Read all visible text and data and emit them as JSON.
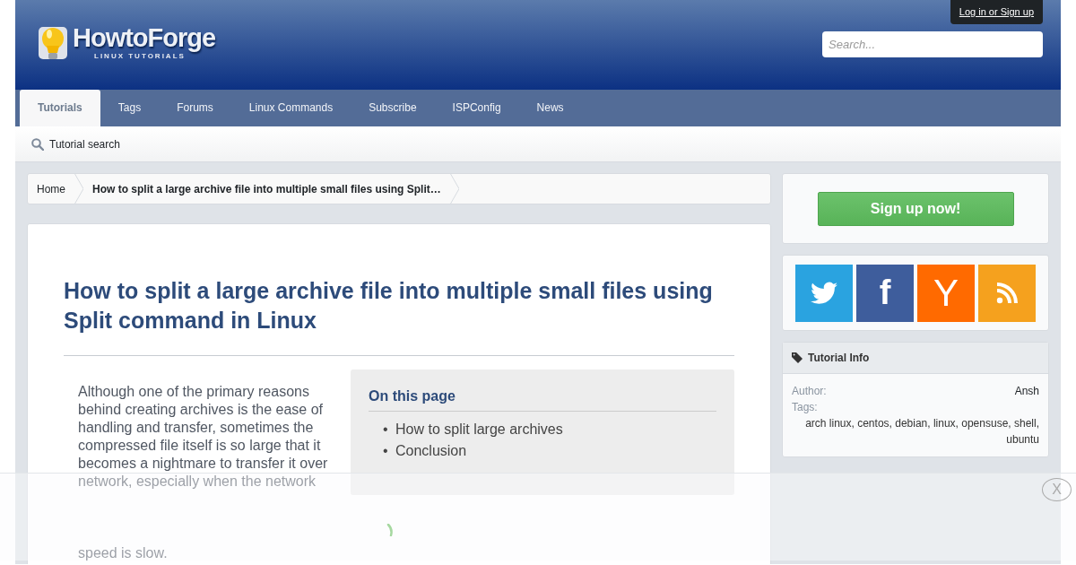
{
  "header": {
    "logo": {
      "name": "HowtoForge",
      "tagline": "LINUX TUTORIALS"
    },
    "login": "Log in or Sign up",
    "search": {
      "placeholder": "Search..."
    }
  },
  "nav": [
    {
      "label": "Tutorials",
      "selected": true
    },
    {
      "label": "Tags",
      "selected": false
    },
    {
      "label": "Forums",
      "selected": false
    },
    {
      "label": "Linux Commands",
      "selected": false
    },
    {
      "label": "Subscribe",
      "selected": false
    },
    {
      "label": "ISPConfig",
      "selected": false
    },
    {
      "label": "News",
      "selected": false
    }
  ],
  "subnav": {
    "search_link": "Tutorial search"
  },
  "breadcrumb": [
    "Home",
    "How to split a large archive file into multiple small files using Split…"
  ],
  "article": {
    "title": "How to split a large archive file into multiple small files using Split command in Linux",
    "intro": "Although one of the primary reasons behind creating archives is the ease of handling and transfer, sometimes the compressed file itself is so large that it becomes a nightmare to transfer it over network, especially when the network",
    "intro_end": "speed is slow.",
    "toc": {
      "title": "On this page",
      "bullet": "•",
      "items": [
        "How to split large archives",
        "Conclusion"
      ]
    }
  },
  "sidebar": {
    "signup": "Sign up now!",
    "social": [
      {
        "kind": "twitter",
        "color": "#2aa3e0"
      },
      {
        "kind": "facebook",
        "glyph": "f",
        "color": "#3e5d9c"
      },
      {
        "kind": "hackernews",
        "glyph": "Y",
        "color": "#ff6a00"
      },
      {
        "kind": "rss",
        "color": "#f5a11e"
      }
    ],
    "info": {
      "title": "Tutorial Info",
      "author_label": "Author:",
      "author": "Ansh",
      "tags_label": "Tags:",
      "tags": "arch linux, centos, debian, linux, opensuse, shell, ubuntu"
    }
  },
  "overlay": {
    "close": "X"
  }
}
